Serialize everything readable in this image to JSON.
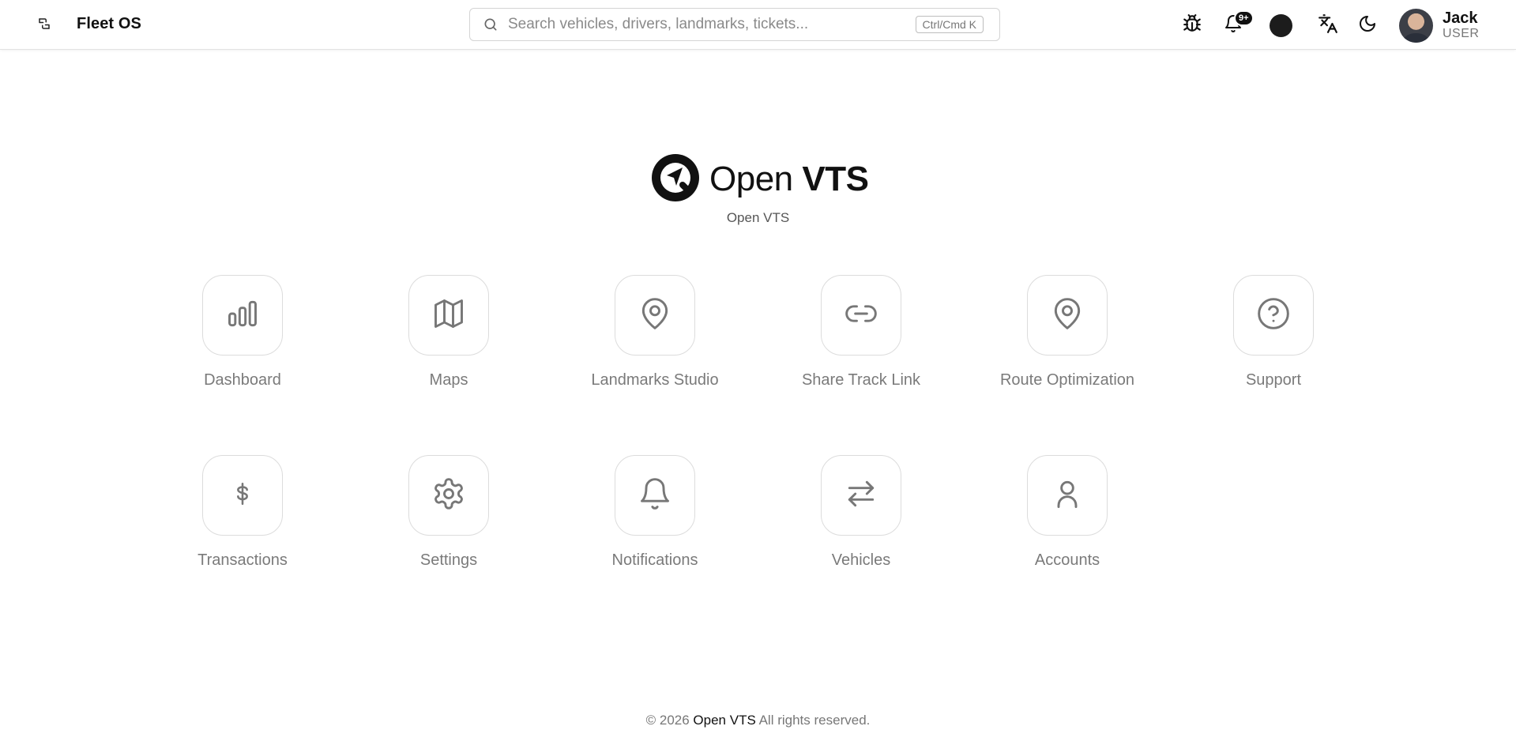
{
  "header": {
    "brand": "Fleet OS",
    "search": {
      "placeholder": "Search vehicles, drivers, landmarks, tickets...",
      "shortcut": "Ctrl/Cmd K"
    },
    "notifications_badge": "9+",
    "theme_color": "#1c1c1c",
    "icons": [
      "sidebar-toggle-icon",
      "bug-icon",
      "bell-icon",
      "theme-swatch",
      "translate-icon",
      "moon-icon"
    ],
    "user": {
      "name": "Jack",
      "role": "USER"
    }
  },
  "hero": {
    "logo_light": "Open",
    "logo_bold": "VTS",
    "tagline": "Open VTS"
  },
  "apps": [
    {
      "label": "Dashboard",
      "icon": "bar-chart-icon"
    },
    {
      "label": "Maps",
      "icon": "map-icon"
    },
    {
      "label": "Landmarks Studio",
      "icon": "map-pin-icon"
    },
    {
      "label": "Share Track Link",
      "icon": "link-icon"
    },
    {
      "label": "Route Optimization",
      "icon": "map-pin-icon"
    },
    {
      "label": "Support",
      "icon": "help-circle-icon"
    },
    {
      "label": "Transactions",
      "icon": "dollar-icon"
    },
    {
      "label": "Settings",
      "icon": "gear-icon"
    },
    {
      "label": "Notifications",
      "icon": "bell-icon"
    },
    {
      "label": "Vehicles",
      "icon": "arrows-swap-icon"
    },
    {
      "label": "Accounts",
      "icon": "user-icon"
    }
  ],
  "footer": {
    "copyright": "© 2026",
    "brand": "Open VTS",
    "rights": "All rights reserved."
  }
}
